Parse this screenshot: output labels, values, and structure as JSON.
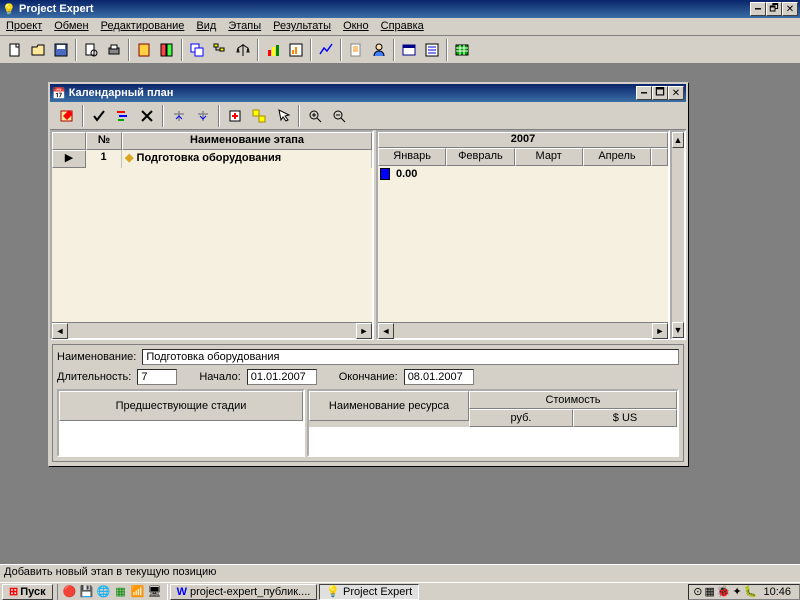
{
  "app": {
    "title": "Project Expert"
  },
  "menu": [
    "Проект",
    "Обмен",
    "Редактирование",
    "Вид",
    "Этапы",
    "Результаты",
    "Окно",
    "Справка"
  ],
  "child": {
    "title": "Календарный план",
    "grid": {
      "headers": {
        "num": "№",
        "name": "Наименование этапа"
      },
      "rows": [
        {
          "num": "1",
          "name": "Подготовка оборудования"
        }
      ]
    },
    "gantt": {
      "year": "2007",
      "months": [
        "Январь",
        "Февраль",
        "Март",
        "Апрель"
      ],
      "bar_value": "0.00"
    },
    "details": {
      "name_label": "Наименование:",
      "name_value": "Подготовка оборудования",
      "duration_label": "Длительность:",
      "duration_value": "7",
      "start_label": "Начало:",
      "start_value": "01.01.2007",
      "end_label": "Окончание:",
      "end_value": "08.01.2007",
      "pred_header": "Предшествующие стадии",
      "res_header": "Наименование ресурса",
      "cost_header": "Стоимость",
      "rub_header": "руб.",
      "usd_header": "$ US"
    }
  },
  "status": "Добавить новый этап в текущую позицию",
  "taskbar": {
    "start": "Пуск",
    "tasks": [
      {
        "label": "project-expert_публик....",
        "active": false
      },
      {
        "label": "Project Expert",
        "active": true
      }
    ],
    "clock": "10:46"
  }
}
